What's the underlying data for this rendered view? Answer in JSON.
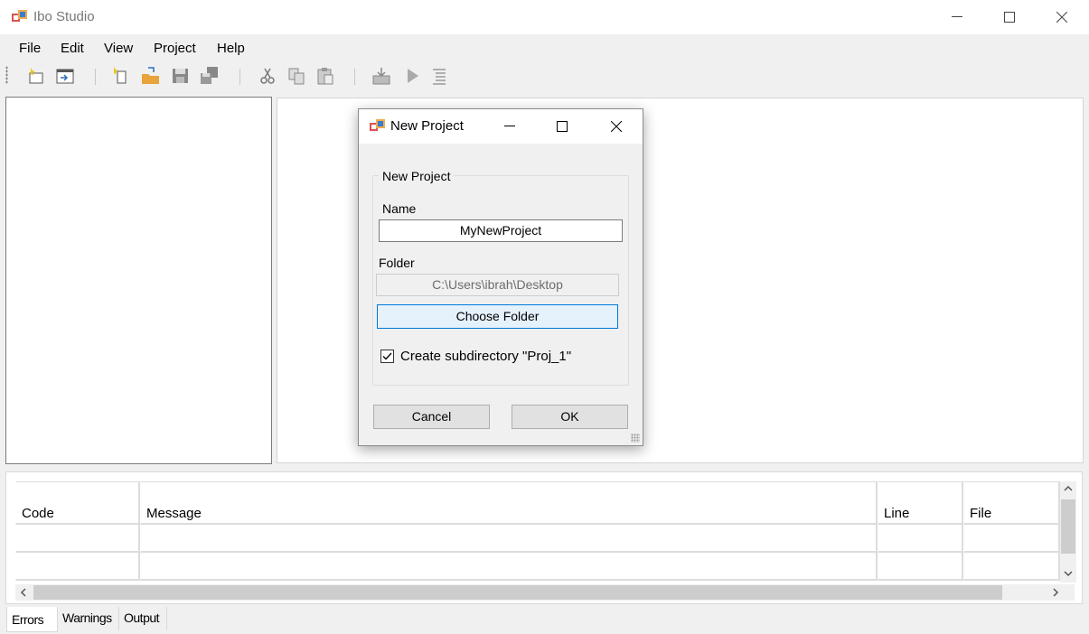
{
  "window": {
    "title": "Ibo Studio"
  },
  "menu": {
    "items": [
      "File",
      "Edit",
      "View",
      "Project",
      "Help"
    ]
  },
  "toolbar": {
    "buttons": [
      "new-project-icon",
      "open-window-icon",
      "new-file-icon",
      "open-folder-icon",
      "save-icon",
      "save-all-icon",
      "cut-icon",
      "copy-icon",
      "paste-icon",
      "build-icon",
      "run-icon",
      "output-list-icon"
    ]
  },
  "dialog": {
    "title": "New Project",
    "group_label": "New Project",
    "name_label": "Name",
    "name_value": "MyNewProject",
    "folder_label": "Folder",
    "folder_value": "C:\\Users\\ibrah\\Desktop",
    "choose_folder_label": "Choose Folder",
    "subdir_label": "Create subdirectory \"Proj_1\"",
    "subdir_checked": true,
    "cancel_label": "Cancel",
    "ok_label": "OK"
  },
  "errors_grid": {
    "columns": [
      "Code",
      "Message",
      "Line",
      "File"
    ],
    "rows": [
      [
        "",
        "",
        "",
        ""
      ],
      [
        "",
        "",
        "",
        ""
      ]
    ]
  },
  "tabs": [
    "Errors",
    "Warnings",
    "Output"
  ],
  "colors": {
    "focus_border": "#0078d7",
    "focus_fill": "#e5f1fb"
  }
}
